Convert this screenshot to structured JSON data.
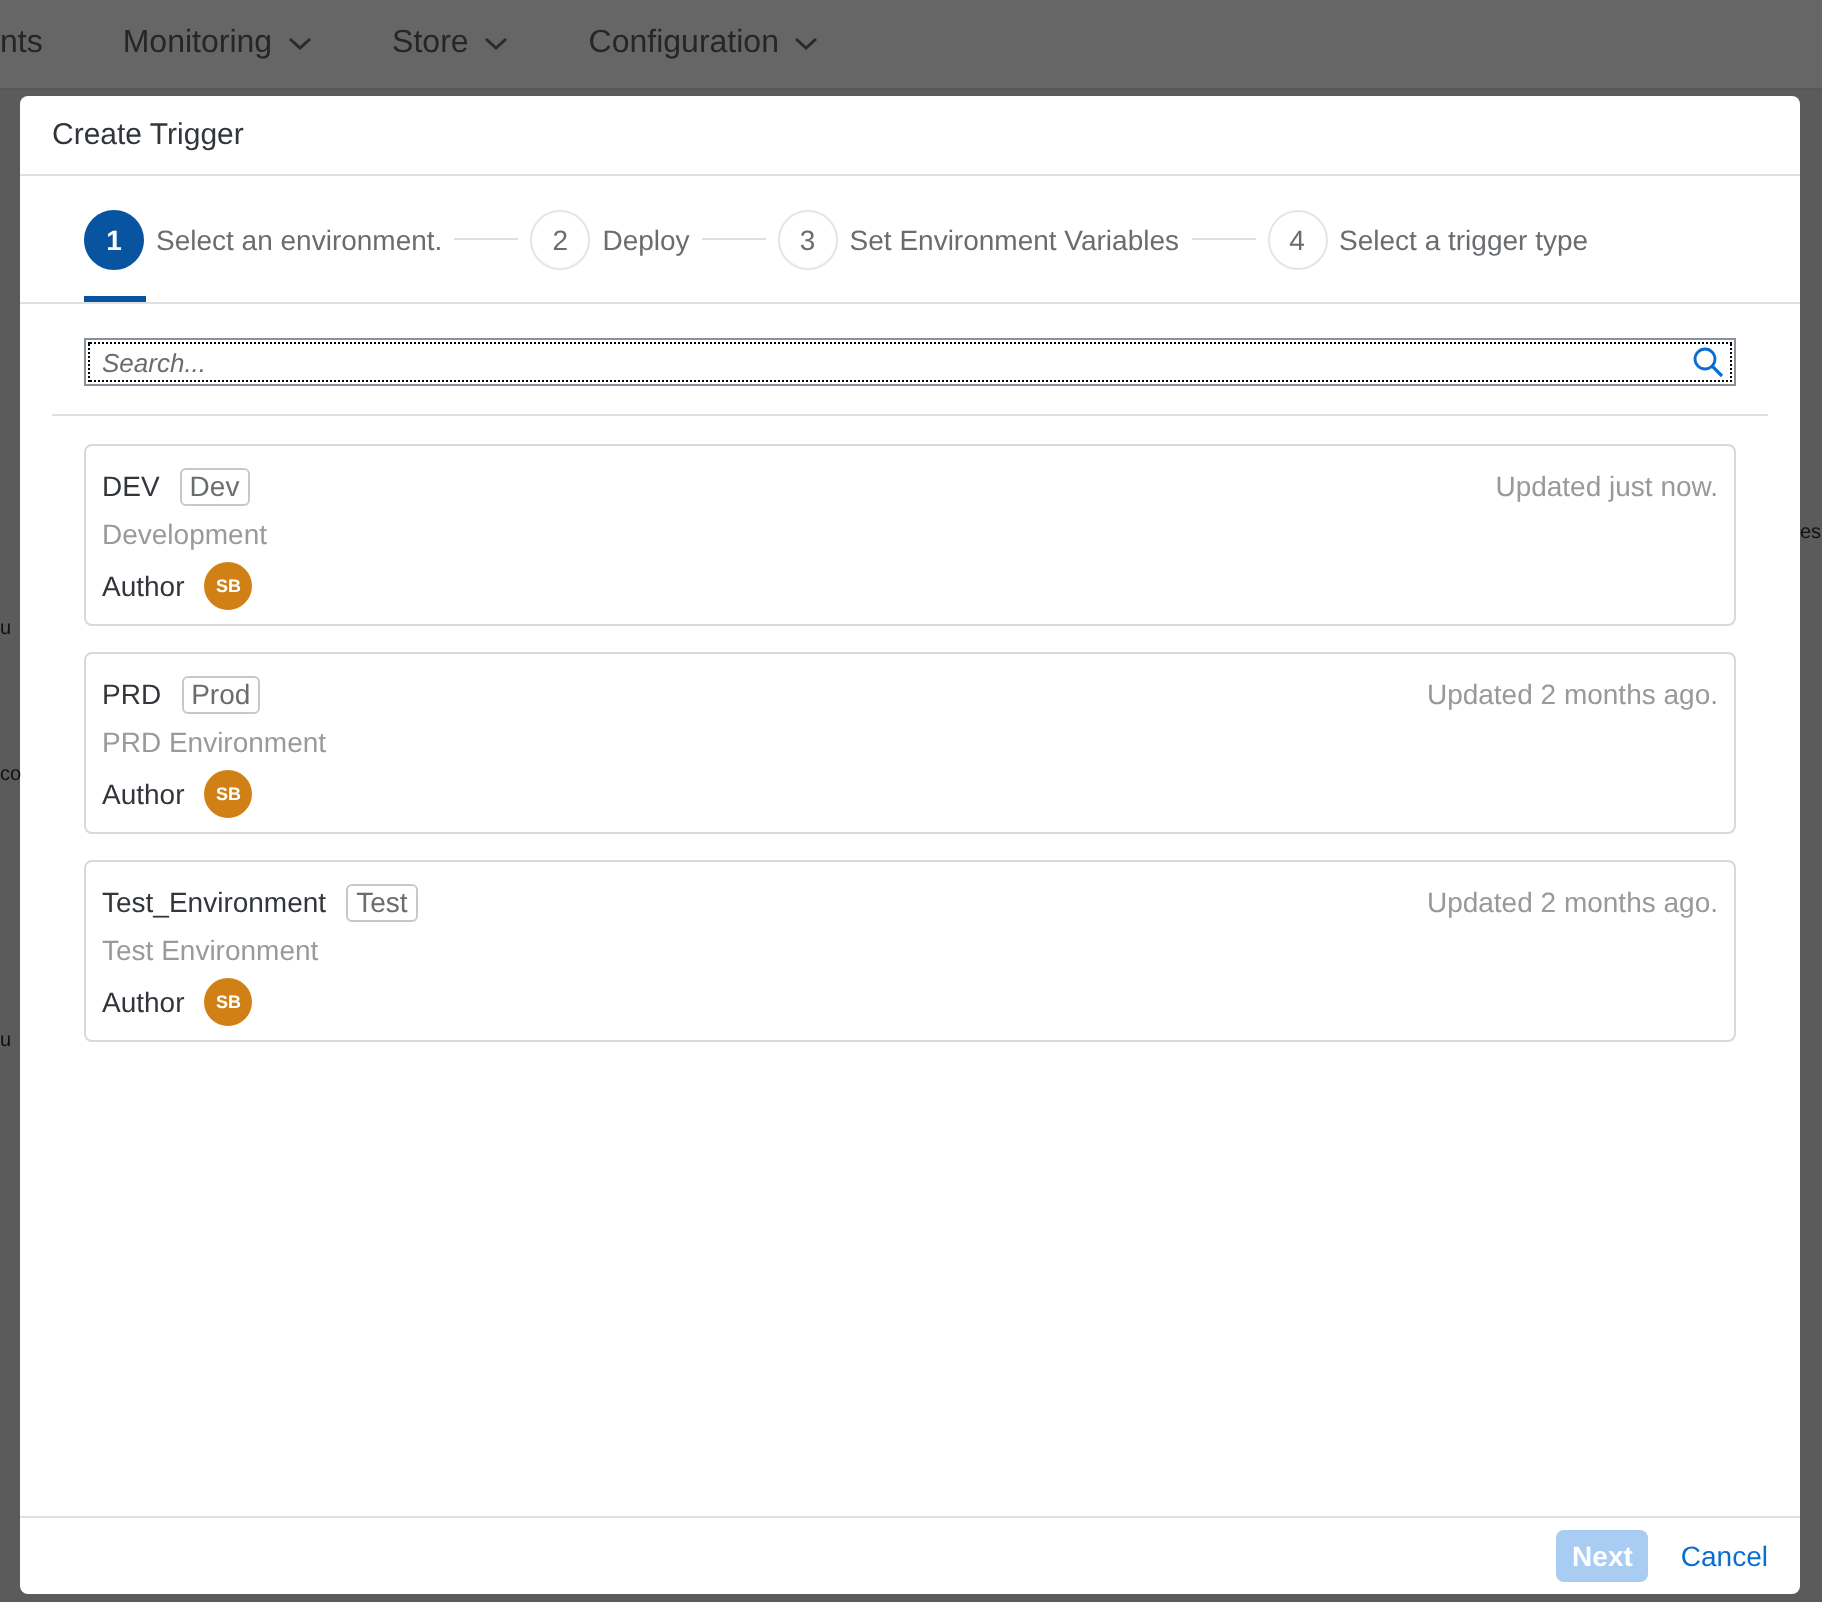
{
  "background": {
    "nav": [
      {
        "label": "nts",
        "caret": false
      },
      {
        "label": "Monitoring",
        "caret": true
      },
      {
        "label": "Store",
        "caret": true
      },
      {
        "label": "Configuration",
        "caret": true
      }
    ],
    "left_fragments": [
      "u",
      "co",
      "u"
    ],
    "right_fragments": [
      "es"
    ]
  },
  "dialog": {
    "title": "Create Trigger",
    "steps": [
      {
        "number": "1",
        "label": "Select an environment.",
        "selected": true
      },
      {
        "number": "2",
        "label": "Deploy",
        "selected": false
      },
      {
        "number": "3",
        "label": "Set Environment Variables",
        "selected": false
      },
      {
        "number": "4",
        "label": "Select a trigger type",
        "selected": false
      }
    ],
    "search": {
      "placeholder": "Search..."
    },
    "environments": [
      {
        "name": "DEV",
        "tag": "Dev",
        "description": "Development",
        "author_label": "Author",
        "author_initials": "SB",
        "updated": "Updated just now."
      },
      {
        "name": "PRD",
        "tag": "Prod",
        "description": "PRD Environment",
        "author_label": "Author",
        "author_initials": "SB",
        "updated": "Updated 2 months ago."
      },
      {
        "name": "Test_Environment",
        "tag": "Test",
        "description": "Test Environment",
        "author_label": "Author",
        "author_initials": "SB",
        "updated": "Updated 2 months ago."
      }
    ],
    "buttons": [
      {
        "label": "Next",
        "kind": "primary",
        "disabled": true
      },
      {
        "label": "Cancel",
        "kind": "link",
        "disabled": false
      }
    ]
  }
}
